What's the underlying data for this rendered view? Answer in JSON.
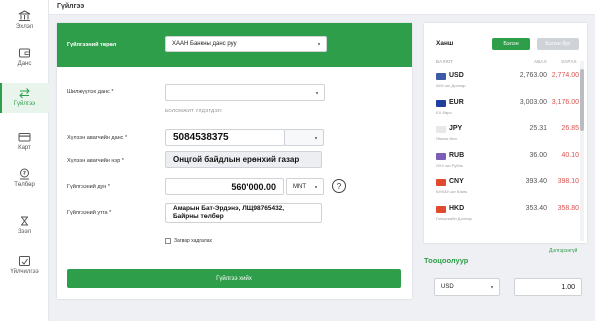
{
  "sidebar": {
    "items": [
      {
        "label": "Эхлэл",
        "icon": "bank-icon"
      },
      {
        "label": "Данс",
        "icon": "account-icon"
      },
      {
        "label": "Гүйлгээ",
        "icon": "transfer-icon"
      },
      {
        "label": "Карт",
        "icon": "card-icon"
      },
      {
        "label": "Төлбөр",
        "icon": "payment-icon"
      },
      {
        "label": "Зээл",
        "icon": "loan-icon"
      },
      {
        "label": "Үйлчилгээ",
        "icon": "service-icon"
      }
    ],
    "active_color": "#2e9e4a"
  },
  "header": {
    "title": "Гүйлгээ"
  },
  "form": {
    "type_label": "Гүйлгээний төрөл",
    "type_value": "ХААН Банкны данс руу",
    "from_account_label": "Шилжүүлэх данс *",
    "from_account_value": "",
    "available_balance_label": "БОЛОМЖИТ ҮЛДЭГДЭЛ:",
    "recipient_account_label": "Хүлээн авагчийн данс *",
    "recipient_account_value": "5084538375",
    "recipient_name_label": "Хүлээн авагчийн нэр *",
    "recipient_name_value": "Онцгой байдлын ерөнхий газар",
    "amount_label": "Гүйлгээний дүн *",
    "amount_value": "560'000.00",
    "currency_value": "MNT",
    "help_icon_text": "?",
    "description_label": "Гүйлгээний утга *",
    "description_line1": "Амарын Бат-Эрдэнэ, ЛЩ98765432,",
    "description_line2": "Байрны төлбөр",
    "save_template_label": "Загвар хадгалах",
    "submit_label": "Гүйлгээ хийх",
    "accent_color": "#2e9e4a"
  },
  "rates": {
    "title": "Ханш",
    "cash_tab": "Бэлэн",
    "noncash_tab": "Бэлэн бус",
    "col_currency": "ВАЛЮТ",
    "col_buy": "АВАХ",
    "col_sell": "ЗАРАХ",
    "rows": [
      {
        "code": "USD",
        "name": "АНУ-ын Доллар",
        "buy": "2,763.00",
        "sell": "2,774.00",
        "flag": "#3c5aa6"
      },
      {
        "code": "EUR",
        "name": "EX Евро",
        "buy": "3,003.00",
        "sell": "3,176.00",
        "flag": "#1f3f9a"
      },
      {
        "code": "JPY",
        "name": "Японы Иен",
        "buy": "25.31",
        "sell": "26.85",
        "flag": "#e8e8e8"
      },
      {
        "code": "RUB",
        "name": "ОХУ-ын Рубль",
        "buy": "36.00",
        "sell": "40.10",
        "flag": "#7b5fb5"
      },
      {
        "code": "CNY",
        "name": "БНХАУ-ын Юань",
        "buy": "393.40",
        "sell": "398.10",
        "flag": "#e04b2e"
      },
      {
        "code": "HKD",
        "name": "Гонконгийн Доллар",
        "buy": "353.40",
        "sell": "358.80",
        "flag": "#e04b2e"
      }
    ],
    "sell_color": "#d9534f"
  },
  "calculator": {
    "link": "Дэлгэрэнгүй",
    "title": "Тооцоолуур",
    "currency_value": "USD",
    "amount_value": "1.00"
  }
}
